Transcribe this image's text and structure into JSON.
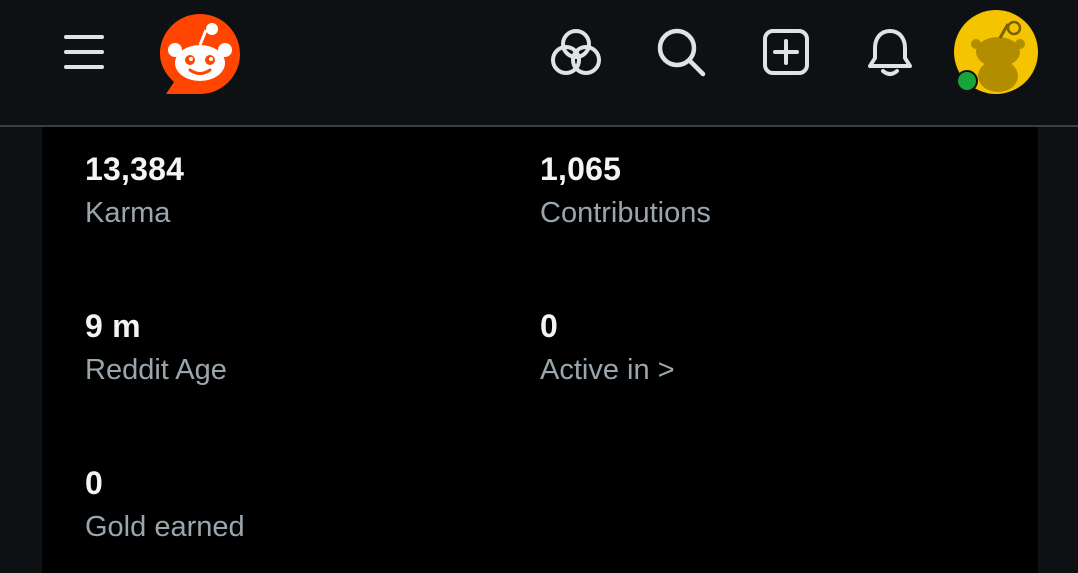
{
  "header": {
    "menu_icon": "hamburger-menu-icon",
    "logo_icon": "reddit-snoo-logo",
    "explore_icon": "explore-communities-icon",
    "search_icon": "search-icon",
    "create_icon": "create-post-icon",
    "notifications_icon": "bell-icon",
    "avatar_icon": "user-avatar",
    "online_status": "online",
    "colors": {
      "brand": "#ff4500",
      "avatar_bg": "#f5c400",
      "online": "#17a43a"
    }
  },
  "stats": {
    "karma": {
      "value": "13,384",
      "label": "Karma"
    },
    "contributions": {
      "value": "1,065",
      "label": "Contributions"
    },
    "reddit_age": {
      "value": "9 m",
      "label": "Reddit Age"
    },
    "active_in": {
      "value": "0",
      "label": "Active in >"
    },
    "gold_earned": {
      "value": "0",
      "label": "Gold earned"
    }
  },
  "colors": {
    "page_bg": "#000000",
    "header_bg": "#0e1113",
    "value_text": "#f2f4f5",
    "label_text": "#9aa6ad"
  }
}
